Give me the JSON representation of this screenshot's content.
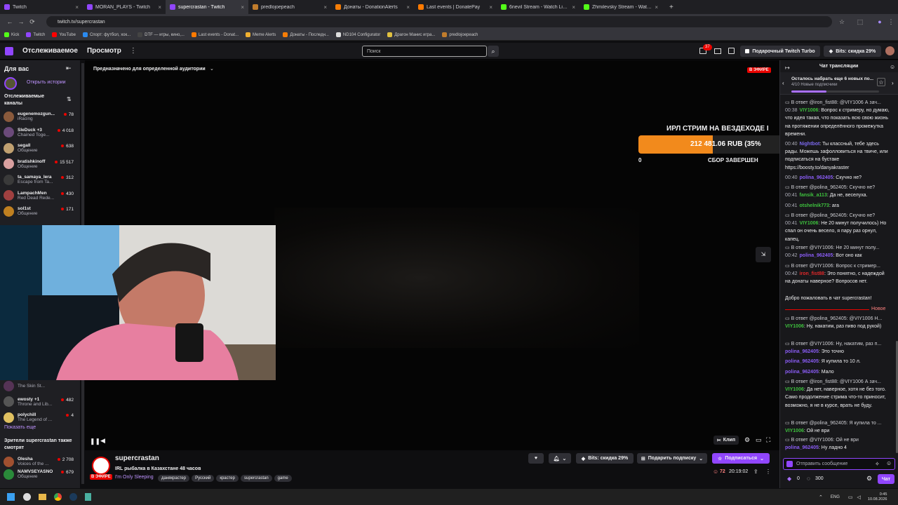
{
  "browser": {
    "tabs": [
      {
        "title": "Twitch",
        "color": "#9146ff"
      },
      {
        "title": "MORAN_PLAYS - Twitch",
        "color": "#9146ff"
      },
      {
        "title": "supercrastan - Twitch",
        "color": "#9146ff"
      },
      {
        "title": "predlojoepeach",
        "color": "#c07c2c"
      },
      {
        "title": "Донаты - DonationAlerts",
        "color": "#f57d07"
      },
      {
        "title": "Last events | DonatePay",
        "color": "#ff7a00"
      },
      {
        "title": "6nevil Stream - Watch Live on K",
        "color": "#53fc18"
      },
      {
        "title": "Zhmilevsky Stream - Watch Live",
        "color": "#53fc18"
      }
    ],
    "url": "twitch.tv/supercrastan",
    "bookmarks": [
      "Kick",
      "Twitch",
      "YouTube",
      "Спорт: футбол, хок...",
      "DTF — игры, кино,...",
      "Last events - Donat...",
      "Meme Alerts",
      "Донаты - Последн...",
      "ND104 Configurator",
      "Драгон Манис игра...",
      "predlojoepeach"
    ]
  },
  "nav": {
    "following": "Отслеживаемое",
    "browse": "Просмотр",
    "search_placeholder": "Поиск",
    "notif_count": "37",
    "gift_turbo": "Подарочный Twitch Turbo",
    "bits": "Bits: скидка 29%"
  },
  "sidebar": {
    "title": "Для вас",
    "history": "Открыть истории",
    "followed": "Отслеживаемые каналы",
    "show_more": "Показать еще",
    "also_watch": "Зрители supercrastan также смотрят",
    "channels": [
      {
        "name": "eugenemozgun...",
        "game": "iRacing",
        "viewers": "78",
        "color": "#8a5a3c"
      },
      {
        "name": "SleDuck +3",
        "game": "Chained Toge...",
        "viewers": "4 018",
        "color": "#6b4a7a"
      },
      {
        "name": "segall",
        "game": "Общение",
        "viewers": "638",
        "color": "#c0a070"
      },
      {
        "name": "bratishkinoff",
        "game": "Общение",
        "viewers": "15 517",
        "color": "#d9a0a0"
      },
      {
        "name": "ta_samaya_lera",
        "game": "Escape from Ta...",
        "viewers": "312",
        "color": "#3a3a3a"
      },
      {
        "name": "LampachMen",
        "game": "Red Dead Rede...",
        "viewers": "430",
        "color": "#a04040"
      },
      {
        "name": "sol1st",
        "game": "Общение",
        "viewers": "171",
        "color": "#c08020"
      }
    ],
    "channels2": [
      {
        "name": "",
        "game": "The Skin St...",
        "viewers": "",
        "color": "#553355"
      },
      {
        "name": "ewosty +1",
        "game": "Throne and Lib...",
        "viewers": "482",
        "color": "#555"
      },
      {
        "name": "polychill",
        "game": "The Legend of ...",
        "viewers": "4",
        "color": "#e0c060"
      }
    ],
    "related": [
      {
        "name": "Olesha",
        "game": "Voices of the ...",
        "viewers": "2 708",
        "color": "#a05030"
      },
      {
        "name": "NAMVSEYASNO",
        "game": "Общение",
        "viewers": "679",
        "color": "#2a8a3a"
      }
    ]
  },
  "player": {
    "audience": "Предназначено для определенной аудитории",
    "live": "В ЭФИРЕ",
    "goal_title": "ИРЛ СТРИМ НА ВЕЗДЕХОДЕ I",
    "goal_amount": "212 481.06 RUB (35%",
    "goal_min": "0",
    "goal_done": "СБОР ЗАВЕРШЕН",
    "goal_progress": 0.35,
    "clip": "Клип"
  },
  "stream": {
    "channel": "supercrastan",
    "title": "IRL рыбалка в Казахстане 48 часов",
    "category": "I'm Only Sleeping",
    "tags": [
      "данякрастер",
      "Русский",
      "крастер",
      "supercrastan",
      "game"
    ],
    "live": "В ЭФИРЕ",
    "bits": "Bits: скидка 29%",
    "gift": "Подарить подписку",
    "subscribe": "Подписаться",
    "viewers": "72",
    "uptime": "20:19:02"
  },
  "chat": {
    "title": "Чат трансляции",
    "goal_text": "Осталось набрать еще 6 новых по...",
    "goal_sub": "4/10 Новые подписчики",
    "goal_progress": 0.4,
    "new_label": "Новое",
    "welcome": "Добро пожаловать в чат supercrastan!",
    "input_placeholder": "Отправить сообщение",
    "points": "0",
    "points2": "300",
    "send": "Чат",
    "messages": [
      {
        "reply": "В ответ @iron_fist88: @VIY1006 А зач...",
        "time": "00:38",
        "user": "VIY1006",
        "color": "#3ec13e",
        "text": ": Вопрос к стримеру, но думаю, что идея такая, что показать всю свою жизнь на протяжении определённого промежутка времени."
      },
      {
        "reply": "",
        "time": "00:40",
        "user": "Nightbot",
        "color": "#7b68ee",
        "text": ": Ты классный, тебе здесь рады. Можешь зафолловиться на твиче, или подписаться на бустаке https://boosty.to/danyakraster"
      },
      {
        "reply": "",
        "time": "00:40",
        "user": "polina_962405",
        "color": "#8a5cf5",
        "text": ": Скучно не?"
      },
      {
        "reply": "В ответ @polina_962405: Скучно не?",
        "time": "00:41",
        "user": "fansik_a113",
        "color": "#3ec13e",
        "text": ": Да не, веселуха."
      },
      {
        "reply": "",
        "time": "00:41",
        "user": "otshelnik773",
        "color": "#3ec13e",
        "text": ": ага"
      },
      {
        "reply": "В ответ @polina_962405: Скучно не?",
        "time": "00:41",
        "user": "VIY1006",
        "color": "#3ec13e",
        "text": ": Не 20 минут получилось) Но спал он очень весело, я пару раз орнул, капец."
      },
      {
        "reply": "В ответ @VIY1006: Не 20 минут полу...",
        "time": "00:42",
        "user": "polina_962405",
        "color": "#8a5cf5",
        "text": ": Вот оно как"
      },
      {
        "reply": "В ответ @VIY1006: Вопрос к стример...",
        "time": "00:42",
        "user": "iron_fist88",
        "color": "#e0282a",
        "text": ": Это понятно, с надеждой на донаты наверное? Вопросов нет."
      }
    ],
    "messages2": [
      {
        "reply": "В ответ @polina_962405: @VIY1006 Н...",
        "user": "VIY1006",
        "color": "#3ec13e",
        "text": ": Ну, накатим, раз пиво под рукой)"
      },
      {
        "reply": "В ответ @VIY1006: Ну, накатим, раз п...",
        "user": "polina_962405",
        "color": "#8a5cf5",
        "text": ": Это точно"
      },
      {
        "reply": "",
        "user": "polina_962405",
        "color": "#8a5cf5",
        "text": ": Я купила то 10 л."
      },
      {
        "reply": "",
        "user": "polina_962405",
        "color": "#8a5cf5",
        "text": ": Мало"
      },
      {
        "reply": "В ответ @iron_fist88: @VIY1006 А зач...",
        "user": "VIY1006",
        "color": "#3ec13e",
        "text": ": Да нет, наверное, хотя не без того. Само продолжение стрима что-то приносит, возможно, я не в курсе, врать не буду."
      },
      {
        "reply": "В ответ @polina_962405: Я купила то ...",
        "user": "VIY1006",
        "color": "#3ec13e",
        "text": ": Ой не ври"
      },
      {
        "reply": "В ответ @VIY1006: Ой не ври",
        "user": "polina_962405",
        "color": "#8a5cf5",
        "text": ": Ну ладно 4"
      }
    ]
  },
  "taskbar": {
    "lang": "ENG",
    "time": "0:45",
    "date": "10.08.2026"
  }
}
